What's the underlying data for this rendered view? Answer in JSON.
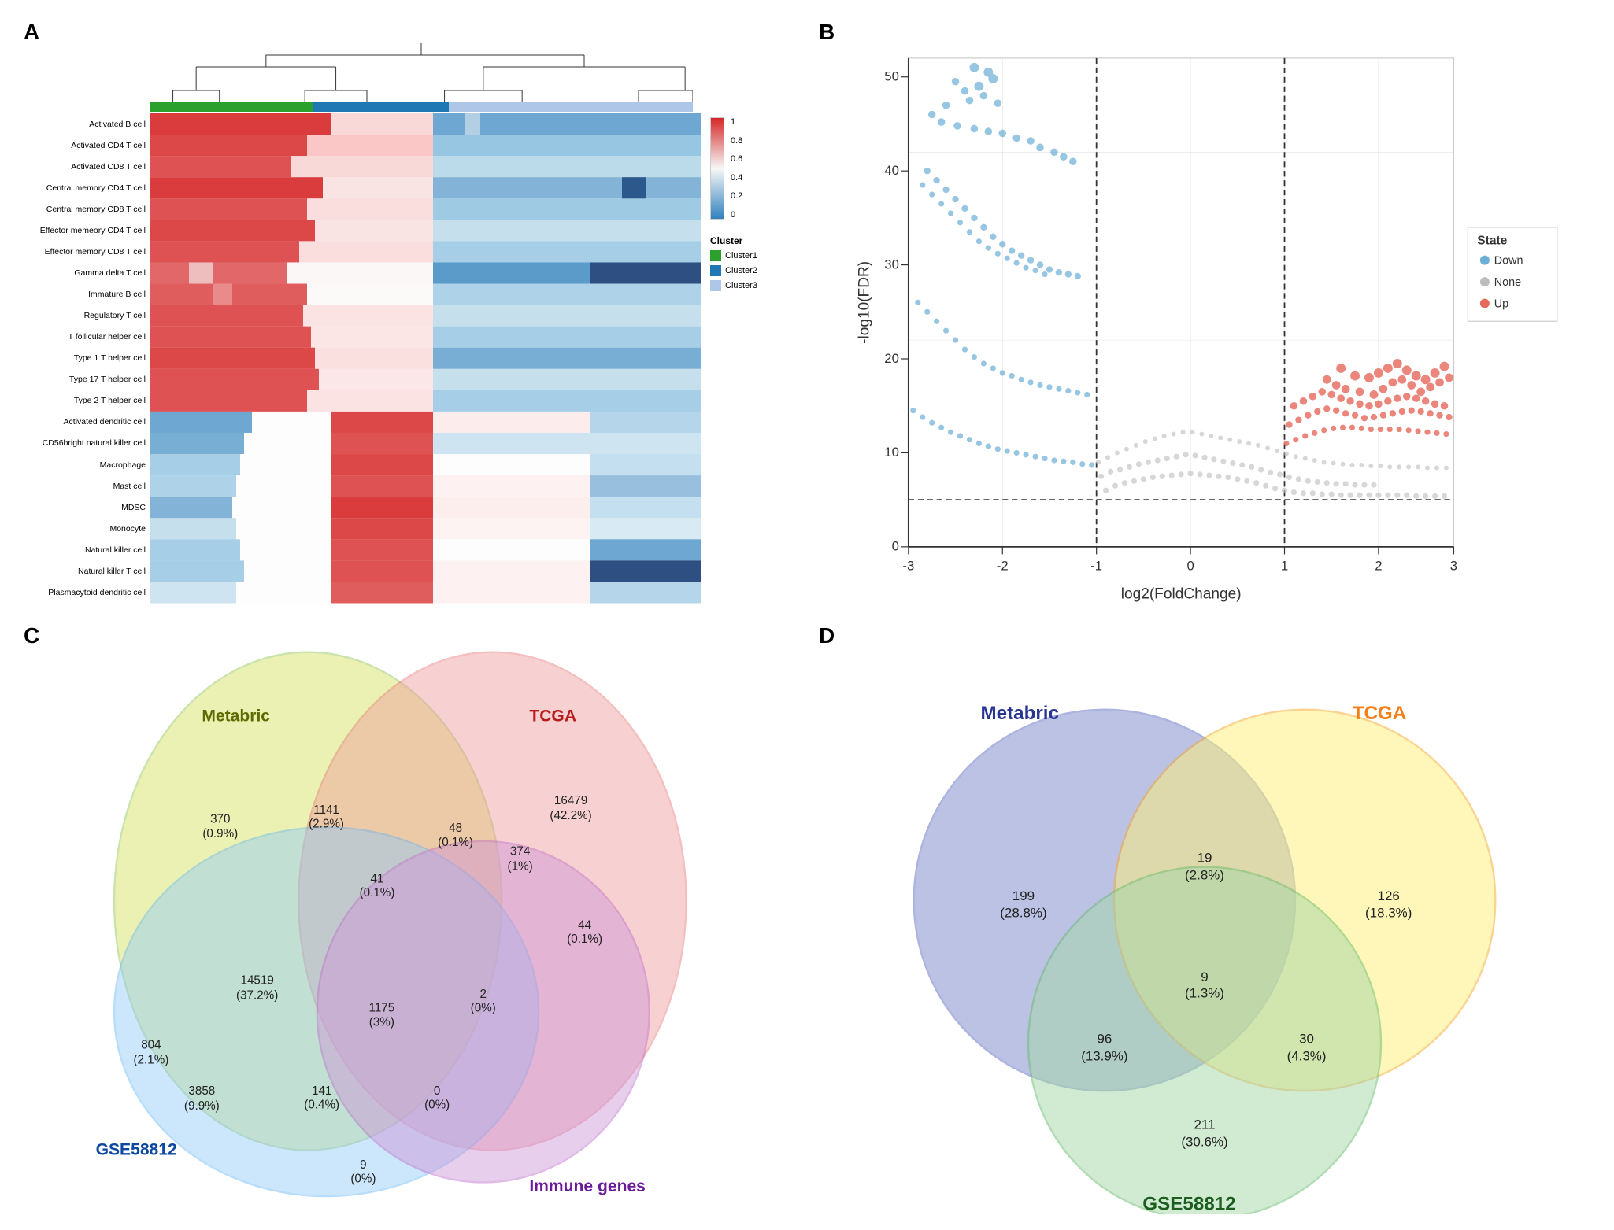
{
  "panels": {
    "a": {
      "label": "A",
      "heatmap_rows": [
        "Activated B cell",
        "Activated CD4 T cell",
        "Activated CD8 T cell",
        "Central memory CD4 T cell",
        "Central memory CD8 T cell",
        "Effector memeory CD4 T cell",
        "Effector memory CD8 T cell",
        "Gamma delta T cell",
        "Immature  B cell",
        "Regulatory T cell",
        "T follicular helper cell",
        "Type 1 T helper cell",
        "Type 17 T helper cell",
        "Type 2 T helper cell",
        "Activated dendritic cell",
        "CD56bright natural killer cell",
        "Macrophage",
        "Mast cell",
        "MDSC",
        "Monocyte",
        "Natural killer cell",
        "Natural killer T cell",
        "Plasmacytoid dendritic cell"
      ],
      "legend": {
        "scale_max": 1,
        "scale_mid": 0.6,
        "scale_mid2": 0.4,
        "scale_mid3": 0.2,
        "scale_min": 0,
        "cluster_title": "Cluster",
        "clusters": [
          {
            "label": "Cluster1",
            "color": "#2ca02c"
          },
          {
            "label": "Cluster2",
            "color": "#1f77b4"
          },
          {
            "label": "Cluster3",
            "color": "#aec7e8"
          }
        ]
      }
    },
    "b": {
      "label": "B",
      "x_label": "log2(FoldChange)",
      "y_label": "-log10(FDR)",
      "legend": {
        "title": "State",
        "items": [
          {
            "label": "Down",
            "color": "#6baed6"
          },
          {
            "label": "None",
            "color": "#bdbdbd"
          },
          {
            "label": "Up",
            "color": "#e6695b"
          }
        ]
      },
      "x_ticks": [
        "-3",
        "-2",
        "-1",
        "0",
        "1"
      ],
      "y_ticks": [
        "0",
        "10",
        "20",
        "30",
        "40"
      ],
      "dashed_x_left": -1,
      "dashed_x_right": 1,
      "dashed_y": 2
    },
    "c": {
      "label": "C",
      "circles": [
        {
          "label": "Metabric",
          "color": "#d4e157",
          "label_color": "#5d6b00"
        },
        {
          "label": "TCGA",
          "color": "#ef9a9a",
          "label_color": "#b71c1c"
        },
        {
          "label": "GSE58812",
          "color": "#90caf9",
          "label_color": "#0d47a1"
        },
        {
          "label": "Immune genes",
          "color": "#ce93d8",
          "label_color": "#4a148c"
        }
      ],
      "values": [
        {
          "text": "370",
          "pct": "(0.9%)",
          "x": 270,
          "y": 200
        },
        {
          "text": "16479",
          "pct": "(42.2%)",
          "x": 570,
          "y": 175
        },
        {
          "text": "41",
          "pct": "(0.1%)",
          "x": 290,
          "y": 265
        },
        {
          "text": "1141",
          "pct": "(2.9%)",
          "x": 420,
          "y": 235
        },
        {
          "text": "374",
          "pct": "(1%)",
          "x": 560,
          "y": 235
        },
        {
          "text": "804",
          "pct": "(2.1%)",
          "x": 130,
          "y": 340
        },
        {
          "text": "14519",
          "pct": "(37.2%)",
          "x": 310,
          "y": 340
        },
        {
          "text": "48",
          "pct": "(0.1%)",
          "x": 490,
          "y": 290
        },
        {
          "text": "44",
          "pct": "(0.1%)",
          "x": 630,
          "y": 310
        },
        {
          "text": "3858",
          "pct": "(9.9%)",
          "x": 195,
          "y": 430
        },
        {
          "text": "1175",
          "pct": "(3%)",
          "x": 365,
          "y": 415
        },
        {
          "text": "2",
          "pct": "(0%)",
          "x": 495,
          "y": 400
        },
        {
          "text": "141",
          "pct": "(0.4%)",
          "x": 295,
          "y": 510
        },
        {
          "text": "0",
          "pct": "(0%)",
          "x": 415,
          "y": 500
        },
        {
          "text": "9",
          "pct": "(0%)",
          "x": 350,
          "y": 575
        }
      ]
    },
    "d": {
      "label": "D",
      "circles": [
        {
          "label": "Metabric",
          "color": "#7986cb",
          "label_color": "#283593"
        },
        {
          "label": "TCGA",
          "color": "#fff176",
          "label_color": "#f57f17"
        },
        {
          "label": "GSE58812",
          "color": "#a5d6a7",
          "label_color": "#1b5e20"
        }
      ],
      "values": [
        {
          "text": "199",
          "pct": "(28.8%)",
          "x": 250,
          "y": 290
        },
        {
          "text": "19",
          "pct": "(2.8%)",
          "x": 430,
          "y": 265
        },
        {
          "text": "126",
          "pct": "(18.3%)",
          "x": 580,
          "y": 290
        },
        {
          "text": "9",
          "pct": "(1.3%)",
          "x": 430,
          "y": 340
        },
        {
          "text": "96",
          "pct": "(13.9%)",
          "x": 310,
          "y": 420
        },
        {
          "text": "30",
          "pct": "(4.3%)",
          "x": 520,
          "y": 420
        },
        {
          "text": "211",
          "pct": "(30.6%)",
          "x": 415,
          "y": 510
        }
      ]
    }
  }
}
